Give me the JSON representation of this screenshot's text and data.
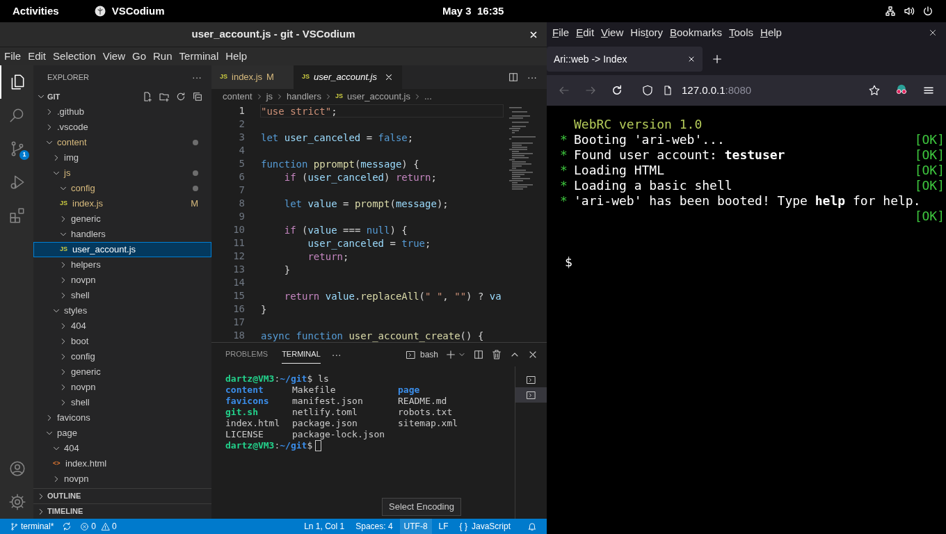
{
  "top_bar": {
    "activities": "Activities",
    "app_name": "VSCodium",
    "clock": "May 3  16:35"
  },
  "vscodium": {
    "title": "user_account.js - git - VSCodium",
    "menu": [
      "File",
      "Edit",
      "Selection",
      "View",
      "Go",
      "Run",
      "Terminal",
      "Help"
    ],
    "activity_bar": [
      {
        "kind": "explorer",
        "selected": true
      },
      {
        "kind": "search",
        "selected": false
      },
      {
        "kind": "scm",
        "selected": false,
        "badge": "1"
      },
      {
        "kind": "debug",
        "selected": false
      },
      {
        "kind": "extensions",
        "selected": false
      }
    ],
    "activity_bar_bottom": [
      {
        "kind": "account"
      },
      {
        "kind": "settings"
      }
    ],
    "explorer": {
      "title": "EXPLORER",
      "more": "···",
      "root": {
        "name": "GIT",
        "expanded": true
      },
      "tree": [
        {
          "name": ".github",
          "kind": "folder",
          "expanded": false,
          "modified": false,
          "selected": false
        },
        {
          "name": ".vscode",
          "kind": "folder",
          "expanded": false,
          "modified": false,
          "selected": false
        },
        {
          "name": "content",
          "kind": "folder",
          "expanded": true,
          "modified": true,
          "selected": false,
          "children": [
            {
              "name": "img",
              "kind": "folder",
              "expanded": false,
              "modified": false,
              "selected": false
            },
            {
              "name": "js",
              "kind": "folder",
              "expanded": true,
              "modified": true,
              "selected": false,
              "children": [
                {
                  "name": "config",
                  "kind": "folder",
                  "expanded": true,
                  "modified": true,
                  "selected": false,
                  "children": [
                    {
                      "name": "index.js",
                      "kind": "file",
                      "icon": "JS",
                      "modified": true,
                      "status_letter": "M",
                      "selected": false
                    }
                  ]
                },
                {
                  "name": "generic",
                  "kind": "folder",
                  "expanded": false,
                  "modified": false,
                  "selected": false
                },
                {
                  "name": "handlers",
                  "kind": "folder",
                  "expanded": true,
                  "modified": false,
                  "selected": false,
                  "children": [
                    {
                      "name": "user_account.js",
                      "kind": "file",
                      "icon": "JS",
                      "modified": false,
                      "selected": true
                    }
                  ]
                },
                {
                  "name": "helpers",
                  "kind": "folder",
                  "expanded": false,
                  "modified": false,
                  "selected": false
                },
                {
                  "name": "novpn",
                  "kind": "folder",
                  "expanded": false,
                  "modified": false,
                  "selected": false
                },
                {
                  "name": "shell",
                  "kind": "folder",
                  "expanded": false,
                  "modified": false,
                  "selected": false
                }
              ]
            },
            {
              "name": "styles",
              "kind": "folder",
              "expanded": true,
              "modified": false,
              "selected": false,
              "children": [
                {
                  "name": "404",
                  "kind": "folder",
                  "expanded": false,
                  "modified": false,
                  "selected": false
                },
                {
                  "name": "boot",
                  "kind": "folder",
                  "expanded": false,
                  "modified": false,
                  "selected": false
                },
                {
                  "name": "config",
                  "kind": "folder",
                  "expanded": false,
                  "modified": false,
                  "selected": false
                },
                {
                  "name": "generic",
                  "kind": "folder",
                  "expanded": false,
                  "modified": false,
                  "selected": false
                },
                {
                  "name": "novpn",
                  "kind": "folder",
                  "expanded": false,
                  "modified": false,
                  "selected": false
                },
                {
                  "name": "shell",
                  "kind": "folder",
                  "expanded": false,
                  "modified": false,
                  "selected": false
                }
              ]
            }
          ]
        },
        {
          "name": "favicons",
          "kind": "folder",
          "expanded": false,
          "modified": false,
          "selected": false
        },
        {
          "name": "page",
          "kind": "folder",
          "expanded": true,
          "modified": false,
          "selected": false,
          "children": [
            {
              "name": "404",
              "kind": "folder",
              "expanded": true,
              "modified": false,
              "selected": false,
              "children": [
                {
                  "name": "index.html",
                  "kind": "file",
                  "icon": "<>",
                  "modified": false,
                  "selected": false
                }
              ]
            },
            {
              "name": "novpn",
              "kind": "folder",
              "expanded": false,
              "modified": false,
              "selected": false
            }
          ]
        }
      ],
      "sections": [
        {
          "name": "OUTLINE",
          "expanded": false
        },
        {
          "name": "TIMELINE",
          "expanded": false
        }
      ]
    },
    "tabs": [
      {
        "label": "index.js",
        "icon": "JS",
        "status_letter": "M",
        "selected": false,
        "preview": false
      },
      {
        "label": "user_account.js",
        "icon": "JS",
        "selected": true,
        "preview": true
      }
    ],
    "tabs_more": "···",
    "breadcrumbs": [
      {
        "text": "content"
      },
      {
        "text": "js"
      },
      {
        "text": "handlers"
      },
      {
        "text": "user_account.js",
        "icon": "JS"
      },
      {
        "text": "..."
      }
    ],
    "code": [
      {
        "number": "1",
        "current": true,
        "tokens": [
          {
            "text": "\"use strict\"",
            "kind": "string"
          },
          {
            "text": ";",
            "kind": "plain"
          }
        ]
      },
      {
        "number": "2",
        "current": false
      },
      {
        "number": "3",
        "current": false,
        "tokens": [
          {
            "text": "let",
            "kind": "keyword"
          },
          {
            "text": " user_canceled",
            "kind": "variable"
          },
          {
            "text": " = ",
            "kind": "plain"
          },
          {
            "text": "false",
            "kind": "keyword"
          },
          {
            "text": ";",
            "kind": "plain"
          }
        ]
      },
      {
        "number": "4",
        "current": false
      },
      {
        "number": "5",
        "current": false,
        "tokens": [
          {
            "text": "function",
            "kind": "keyword"
          },
          {
            "text": " pprompt",
            "kind": "function"
          },
          {
            "text": "(",
            "kind": "plain"
          },
          {
            "text": "message",
            "kind": "variable"
          },
          {
            "text": ") {",
            "kind": "plain"
          }
        ]
      },
      {
        "number": "6",
        "current": false,
        "tokens": [
          {
            "text": "    if",
            "kind": "control"
          },
          {
            "text": " (",
            "kind": "plain"
          },
          {
            "text": "user_canceled",
            "kind": "variable"
          },
          {
            "text": ") ",
            "kind": "plain"
          },
          {
            "text": "return",
            "kind": "control"
          },
          {
            "text": ";",
            "kind": "plain"
          }
        ]
      },
      {
        "number": "7",
        "current": false
      },
      {
        "number": "8",
        "current": false,
        "tokens": [
          {
            "text": "    let",
            "kind": "keyword"
          },
          {
            "text": " value",
            "kind": "variable"
          },
          {
            "text": " = ",
            "kind": "plain"
          },
          {
            "text": "prompt",
            "kind": "function"
          },
          {
            "text": "(",
            "kind": "plain"
          },
          {
            "text": "message",
            "kind": "variable"
          },
          {
            "text": ");",
            "kind": "plain"
          }
        ]
      },
      {
        "number": "9",
        "current": false
      },
      {
        "number": "10",
        "current": false,
        "tokens": [
          {
            "text": "    if",
            "kind": "control"
          },
          {
            "text": " (",
            "kind": "plain"
          },
          {
            "text": "value",
            "kind": "variable"
          },
          {
            "text": " === ",
            "kind": "plain"
          },
          {
            "text": "null",
            "kind": "keyword"
          },
          {
            "text": ") {",
            "kind": "plain"
          }
        ]
      },
      {
        "number": "11",
        "current": false,
        "tokens": [
          {
            "text": "        user_canceled",
            "kind": "variable"
          },
          {
            "text": " = ",
            "kind": "plain"
          },
          {
            "text": "true",
            "kind": "keyword"
          },
          {
            "text": ";",
            "kind": "plain"
          }
        ]
      },
      {
        "number": "12",
        "current": false,
        "tokens": [
          {
            "text": "        return",
            "kind": "control"
          },
          {
            "text": ";",
            "kind": "plain"
          }
        ]
      },
      {
        "number": "13",
        "current": false,
        "tokens": [
          {
            "text": "    }",
            "kind": "plain"
          }
        ]
      },
      {
        "number": "14",
        "current": false
      },
      {
        "number": "15",
        "current": false,
        "tokens": [
          {
            "text": "    return",
            "kind": "control"
          },
          {
            "text": " value",
            "kind": "variable"
          },
          {
            "text": ".",
            "kind": "plain"
          },
          {
            "text": "replaceAll",
            "kind": "function"
          },
          {
            "text": "(",
            "kind": "plain"
          },
          {
            "text": "\" \"",
            "kind": "string"
          },
          {
            "text": ", ",
            "kind": "plain"
          },
          {
            "text": "\"\"",
            "kind": "string"
          },
          {
            "text": ") ? ",
            "kind": "plain"
          },
          {
            "text": "va",
            "kind": "variable"
          }
        ]
      },
      {
        "number": "16",
        "current": false,
        "tokens": [
          {
            "text": "}",
            "kind": "plain"
          }
        ]
      },
      {
        "number": "17",
        "current": false
      },
      {
        "number": "18",
        "current": false,
        "tokens": [
          {
            "text": "async",
            "kind": "keyword"
          },
          {
            "text": " function",
            "kind": "keyword"
          },
          {
            "text": " user_account_create",
            "kind": "function"
          },
          {
            "text": "() {",
            "kind": "plain"
          }
        ]
      }
    ],
    "panel": {
      "tabs": [
        {
          "label": "PROBLEMS",
          "selected": false
        },
        {
          "label": "TERMINAL",
          "selected": true
        }
      ],
      "more": "···",
      "shell": "bash",
      "terminal": [
        {
          "kind": "prompt",
          "user": "dartz@VM3",
          "sep": ":",
          "path": "~/git",
          "symbol": "$",
          "command": " ls"
        },
        {
          "kind": "listing",
          "entries": [
            {
              "text": "content",
              "kind": "dir"
            },
            {
              "text": "Makefile",
              "kind": "file"
            },
            {
              "text": "page",
              "kind": "dir"
            }
          ]
        },
        {
          "kind": "listing",
          "entries": [
            {
              "text": "favicons",
              "kind": "dir"
            },
            {
              "text": "manifest.json",
              "kind": "file"
            },
            {
              "text": "README.md",
              "kind": "file"
            }
          ]
        },
        {
          "kind": "listing",
          "entries": [
            {
              "text": "git.sh",
              "kind": "exec"
            },
            {
              "text": "netlify.toml",
              "kind": "file"
            },
            {
              "text": "robots.txt",
              "kind": "file"
            }
          ]
        },
        {
          "kind": "listing",
          "entries": [
            {
              "text": "index.html",
              "kind": "file"
            },
            {
              "text": "package.json",
              "kind": "file"
            },
            {
              "text": "sitemap.xml",
              "kind": "file"
            }
          ]
        },
        {
          "kind": "listing",
          "entries": [
            {
              "text": "LICENSE",
              "kind": "file"
            },
            {
              "text": "package-lock.json",
              "kind": "file"
            }
          ]
        },
        {
          "kind": "prompt",
          "user": "dartz@VM3",
          "sep": ":",
          "path": "~/git",
          "symbol": "$",
          "cursor": true
        }
      ],
      "terminal_list": [
        {
          "selected": false
        },
        {
          "selected": true
        }
      ]
    },
    "tooltip": "Select Encoding",
    "status_bar": {
      "branch": "terminal*",
      "errors": "0",
      "warnings": "0",
      "items": [
        {
          "text": "Ln 1, Col 1",
          "hovered": false
        },
        {
          "text": "Spaces: 4",
          "hovered": false
        },
        {
          "text": "UTF-8",
          "hovered": true
        },
        {
          "text": "LF",
          "hovered": false
        },
        {
          "text": "JavaScript",
          "icon": "{ }",
          "hovered": false
        }
      ]
    }
  },
  "browser": {
    "menu": [
      {
        "key": "F",
        "post": "ile"
      },
      {
        "key": "E",
        "post": "dit"
      },
      {
        "key": "V",
        "post": "iew"
      },
      {
        "pre": "His",
        "key": "t",
        "post": "ory"
      },
      {
        "key": "B",
        "post": "ookmarks"
      },
      {
        "key": "T",
        "post": "ools"
      },
      {
        "key": "H",
        "post": "elp"
      }
    ],
    "tabs": [
      {
        "title": "Ari::web -> Index",
        "selected": true
      }
    ],
    "nav": {
      "back_disabled": true,
      "forward_disabled": true
    },
    "url": {
      "host": "127.0.0.1",
      "port": ":8080"
    },
    "page": {
      "header": "WebRC version 1.0",
      "lines": [
        {
          "bullet": "*",
          "text": "Booting 'ari-web'...",
          "status": "[OK]"
        },
        {
          "bullet": "*",
          "text": "Found user account: **testuser**",
          "status": "[OK]"
        },
        {
          "bullet": "*",
          "text": "Loading HTML",
          "status": "[OK]"
        },
        {
          "bullet": "*",
          "text": "Loading a basic shell",
          "status": "[OK]"
        },
        {
          "bullet": "*",
          "text": "'ari-web' has been booted! Type **help** for help.",
          "status": "[OK]"
        }
      ],
      "prompt": "$"
    }
  }
}
